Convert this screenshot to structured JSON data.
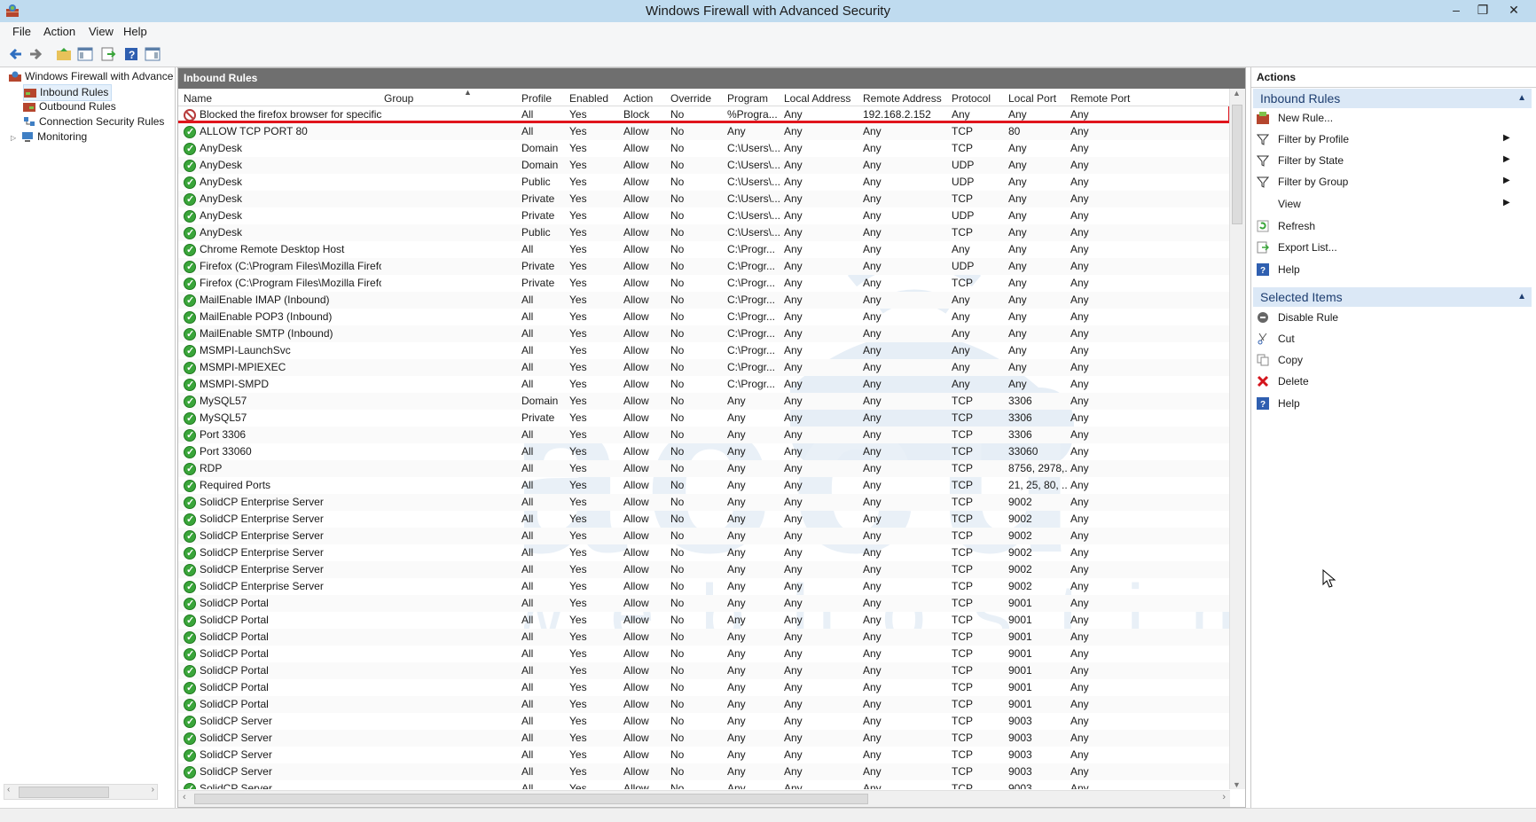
{
  "window": {
    "title": "Windows Firewall with Advanced Security",
    "min": "–",
    "restore": "❐",
    "close": "✕"
  },
  "menu": [
    "File",
    "Action",
    "View",
    "Help"
  ],
  "tree": {
    "root": "Windows Firewall with Advance",
    "items": [
      "Inbound Rules",
      "Outbound Rules",
      "Connection Security Rules",
      "Monitoring"
    ]
  },
  "center": {
    "header": "Inbound Rules",
    "columns": [
      "Name",
      "Group",
      "Profile",
      "Enabled",
      "Action",
      "Override",
      "Program",
      "Local Address",
      "Remote Address",
      "Protocol",
      "Local Port",
      "Remote Port"
    ],
    "rows": [
      [
        "Blocked the firefox browser for specific ip...",
        "",
        "All",
        "Yes",
        "Block",
        "No",
        "%Progra...",
        "Any",
        "192.168.2.152",
        "Any",
        "Any",
        "Any"
      ],
      [
        "ALLOW TCP PORT 80",
        "",
        "All",
        "Yes",
        "Allow",
        "No",
        "Any",
        "Any",
        "Any",
        "TCP",
        "80",
        "Any"
      ],
      [
        "AnyDesk",
        "",
        "Domain",
        "Yes",
        "Allow",
        "No",
        "C:\\Users\\...",
        "Any",
        "Any",
        "TCP",
        "Any",
        "Any"
      ],
      [
        "AnyDesk",
        "",
        "Domain",
        "Yes",
        "Allow",
        "No",
        "C:\\Users\\...",
        "Any",
        "Any",
        "UDP",
        "Any",
        "Any"
      ],
      [
        "AnyDesk",
        "",
        "Public",
        "Yes",
        "Allow",
        "No",
        "C:\\Users\\...",
        "Any",
        "Any",
        "UDP",
        "Any",
        "Any"
      ],
      [
        "AnyDesk",
        "",
        "Private",
        "Yes",
        "Allow",
        "No",
        "C:\\Users\\...",
        "Any",
        "Any",
        "TCP",
        "Any",
        "Any"
      ],
      [
        "AnyDesk",
        "",
        "Private",
        "Yes",
        "Allow",
        "No",
        "C:\\Users\\...",
        "Any",
        "Any",
        "UDP",
        "Any",
        "Any"
      ],
      [
        "AnyDesk",
        "",
        "Public",
        "Yes",
        "Allow",
        "No",
        "C:\\Users\\...",
        "Any",
        "Any",
        "TCP",
        "Any",
        "Any"
      ],
      [
        "Chrome Remote Desktop Host",
        "",
        "All",
        "Yes",
        "Allow",
        "No",
        "C:\\Progr...",
        "Any",
        "Any",
        "Any",
        "Any",
        "Any"
      ],
      [
        "Firefox (C:\\Program Files\\Mozilla Firefox)",
        "",
        "Private",
        "Yes",
        "Allow",
        "No",
        "C:\\Progr...",
        "Any",
        "Any",
        "UDP",
        "Any",
        "Any"
      ],
      [
        "Firefox (C:\\Program Files\\Mozilla Firefox)",
        "",
        "Private",
        "Yes",
        "Allow",
        "No",
        "C:\\Progr...",
        "Any",
        "Any",
        "TCP",
        "Any",
        "Any"
      ],
      [
        "MailEnable IMAP (Inbound)",
        "",
        "All",
        "Yes",
        "Allow",
        "No",
        "C:\\Progr...",
        "Any",
        "Any",
        "Any",
        "Any",
        "Any"
      ],
      [
        "MailEnable POP3 (Inbound)",
        "",
        "All",
        "Yes",
        "Allow",
        "No",
        "C:\\Progr...",
        "Any",
        "Any",
        "Any",
        "Any",
        "Any"
      ],
      [
        "MailEnable SMTP (Inbound)",
        "",
        "All",
        "Yes",
        "Allow",
        "No",
        "C:\\Progr...",
        "Any",
        "Any",
        "Any",
        "Any",
        "Any"
      ],
      [
        "MSMPI-LaunchSvc",
        "",
        "All",
        "Yes",
        "Allow",
        "No",
        "C:\\Progr...",
        "Any",
        "Any",
        "Any",
        "Any",
        "Any"
      ],
      [
        "MSMPI-MPIEXEC",
        "",
        "All",
        "Yes",
        "Allow",
        "No",
        "C:\\Progr...",
        "Any",
        "Any",
        "Any",
        "Any",
        "Any"
      ],
      [
        "MSMPI-SMPD",
        "",
        "All",
        "Yes",
        "Allow",
        "No",
        "C:\\Progr...",
        "Any",
        "Any",
        "Any",
        "Any",
        "Any"
      ],
      [
        "MySQL57",
        "",
        "Domain",
        "Yes",
        "Allow",
        "No",
        "Any",
        "Any",
        "Any",
        "TCP",
        "3306",
        "Any"
      ],
      [
        "MySQL57",
        "",
        "Private",
        "Yes",
        "Allow",
        "No",
        "Any",
        "Any",
        "Any",
        "TCP",
        "3306",
        "Any"
      ],
      [
        "Port 3306",
        "",
        "All",
        "Yes",
        "Allow",
        "No",
        "Any",
        "Any",
        "Any",
        "TCP",
        "3306",
        "Any"
      ],
      [
        "Port 33060",
        "",
        "All",
        "Yes",
        "Allow",
        "No",
        "Any",
        "Any",
        "Any",
        "TCP",
        "33060",
        "Any"
      ],
      [
        "RDP",
        "",
        "All",
        "Yes",
        "Allow",
        "No",
        "Any",
        "Any",
        "Any",
        "TCP",
        "8756, 2978,...",
        "Any"
      ],
      [
        "Required Ports",
        "",
        "All",
        "Yes",
        "Allow",
        "No",
        "Any",
        "Any",
        "Any",
        "TCP",
        "21, 25, 80, ...",
        "Any"
      ],
      [
        "SolidCP Enterprise Server",
        "",
        "All",
        "Yes",
        "Allow",
        "No",
        "Any",
        "Any",
        "Any",
        "TCP",
        "9002",
        "Any"
      ],
      [
        "SolidCP Enterprise Server",
        "",
        "All",
        "Yes",
        "Allow",
        "No",
        "Any",
        "Any",
        "Any",
        "TCP",
        "9002",
        "Any"
      ],
      [
        "SolidCP Enterprise Server",
        "",
        "All",
        "Yes",
        "Allow",
        "No",
        "Any",
        "Any",
        "Any",
        "TCP",
        "9002",
        "Any"
      ],
      [
        "SolidCP Enterprise Server",
        "",
        "All",
        "Yes",
        "Allow",
        "No",
        "Any",
        "Any",
        "Any",
        "TCP",
        "9002",
        "Any"
      ],
      [
        "SolidCP Enterprise Server",
        "",
        "All",
        "Yes",
        "Allow",
        "No",
        "Any",
        "Any",
        "Any",
        "TCP",
        "9002",
        "Any"
      ],
      [
        "SolidCP Enterprise Server",
        "",
        "All",
        "Yes",
        "Allow",
        "No",
        "Any",
        "Any",
        "Any",
        "TCP",
        "9002",
        "Any"
      ],
      [
        "SolidCP Portal",
        "",
        "All",
        "Yes",
        "Allow",
        "No",
        "Any",
        "Any",
        "Any",
        "TCP",
        "9001",
        "Any"
      ],
      [
        "SolidCP Portal",
        "",
        "All",
        "Yes",
        "Allow",
        "No",
        "Any",
        "Any",
        "Any",
        "TCP",
        "9001",
        "Any"
      ],
      [
        "SolidCP Portal",
        "",
        "All",
        "Yes",
        "Allow",
        "No",
        "Any",
        "Any",
        "Any",
        "TCP",
        "9001",
        "Any"
      ],
      [
        "SolidCP Portal",
        "",
        "All",
        "Yes",
        "Allow",
        "No",
        "Any",
        "Any",
        "Any",
        "TCP",
        "9001",
        "Any"
      ],
      [
        "SolidCP Portal",
        "",
        "All",
        "Yes",
        "Allow",
        "No",
        "Any",
        "Any",
        "Any",
        "TCP",
        "9001",
        "Any"
      ],
      [
        "SolidCP Portal",
        "",
        "All",
        "Yes",
        "Allow",
        "No",
        "Any",
        "Any",
        "Any",
        "TCP",
        "9001",
        "Any"
      ],
      [
        "SolidCP Portal",
        "",
        "All",
        "Yes",
        "Allow",
        "No",
        "Any",
        "Any",
        "Any",
        "TCP",
        "9001",
        "Any"
      ],
      [
        "SolidCP Server",
        "",
        "All",
        "Yes",
        "Allow",
        "No",
        "Any",
        "Any",
        "Any",
        "TCP",
        "9003",
        "Any"
      ],
      [
        "SolidCP Server",
        "",
        "All",
        "Yes",
        "Allow",
        "No",
        "Any",
        "Any",
        "Any",
        "TCP",
        "9003",
        "Any"
      ],
      [
        "SolidCP Server",
        "",
        "All",
        "Yes",
        "Allow",
        "No",
        "Any",
        "Any",
        "Any",
        "TCP",
        "9003",
        "Any"
      ],
      [
        "SolidCP Server",
        "",
        "All",
        "Yes",
        "Allow",
        "No",
        "Any",
        "Any",
        "Any",
        "TCP",
        "9003",
        "Any"
      ],
      [
        "SolidCP Server",
        "",
        "All",
        "Yes",
        "Allow",
        "No",
        "Any",
        "Any",
        "Any",
        "TCP",
        "9003",
        "Any"
      ]
    ]
  },
  "actions": {
    "title": "Actions",
    "section1": "Inbound Rules",
    "section1_items": [
      "New Rule...",
      "Filter by Profile",
      "Filter by State",
      "Filter by Group",
      "View",
      "Refresh",
      "Export List...",
      "Help"
    ],
    "section2": "Selected Items",
    "section2_items": [
      "Disable Rule",
      "Cut",
      "Copy",
      "Delete",
      "Help"
    ]
  },
  "watermark": {
    "brand": "accu",
    "tagline": "webhosting"
  },
  "colors": {
    "highlight": "#e0141c",
    "allow": "#3aa53a",
    "block": "#b73a3a",
    "section_bg": "#dbe8f6"
  }
}
